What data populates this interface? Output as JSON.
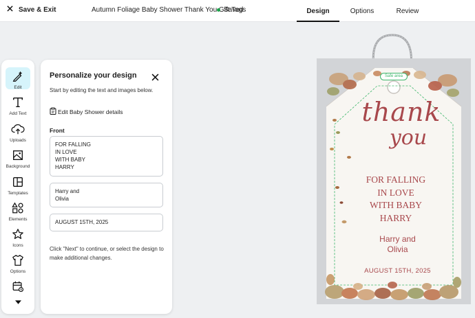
{
  "topbar": {
    "save_exit": "Save & Exit",
    "doc_title": "Autumn Foliage Baby Shower Thank You Gift Tags",
    "status": "Saved",
    "tabs": [
      "Design",
      "Options",
      "Review"
    ],
    "active_tab": "Design"
  },
  "rail": {
    "items": [
      {
        "label": "Edit",
        "icon": "edit-icon"
      },
      {
        "label": "Add Text",
        "icon": "text-icon"
      },
      {
        "label": "Uploads",
        "icon": "upload-cloud-icon"
      },
      {
        "label": "Background",
        "icon": "image-icon"
      },
      {
        "label": "Templates",
        "icon": "template-icon"
      },
      {
        "label": "Elements",
        "icon": "shapes-icon"
      },
      {
        "label": "Icons",
        "icon": "star-icon"
      },
      {
        "label": "Options",
        "icon": "shirt-icon"
      },
      {
        "label": "",
        "icon": "calendar-icon"
      }
    ],
    "more_icon": "chevron-down-icon"
  },
  "panel": {
    "title": "Personalize your design",
    "intro": "Start by editing the text and images below.",
    "edit_details": "Edit Baby Shower details",
    "front_label": "Front",
    "field_message": "FOR FALLING\nIN LOVE\nWITH BABY\nHARRY",
    "field_names": "Harry and\nOlivia",
    "field_date": "AUGUST 15TH, 2025",
    "help": "Click \"Next\" to continue, or select the design to make additional changes."
  },
  "tag": {
    "safe_area": "Safe area",
    "script_line1": "thank",
    "script_line2": "you",
    "message": [
      "FOR FALLING",
      "IN LOVE",
      "WITH BABY",
      "HARRY"
    ],
    "names": [
      "Harry and",
      "Olivia"
    ],
    "date": "AUGUST 15TH, 2025",
    "accent_color": "#a8484c",
    "safe_color": "#3cb66a"
  }
}
